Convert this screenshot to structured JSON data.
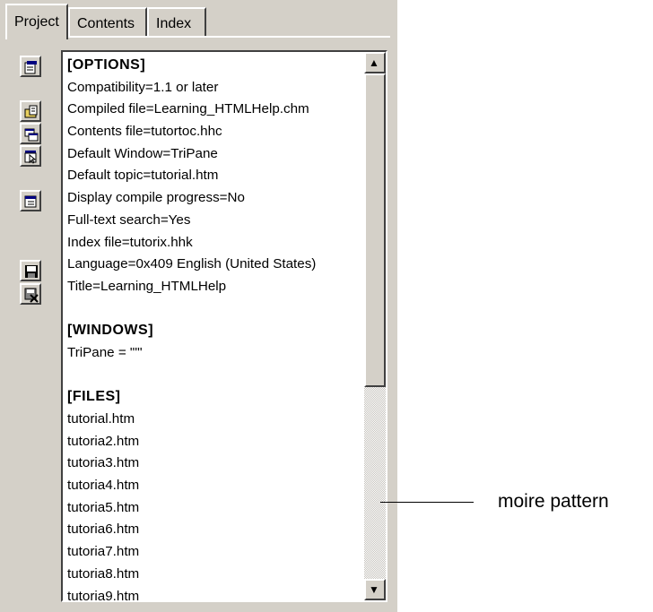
{
  "tabs": [
    {
      "label": "Project",
      "active": true
    },
    {
      "label": "Contents",
      "active": false
    },
    {
      "label": "Index",
      "active": false
    }
  ],
  "toolbar": {
    "buttons": [
      {
        "icon": "change-options-icon"
      },
      {
        "icon": "add-remove-files-icon"
      },
      {
        "icon": "add-modify-window-icon"
      },
      {
        "icon": "html-api-information-icon"
      },
      {
        "icon": "add-modify-information-types-icon"
      },
      {
        "icon": "save-project-icon"
      },
      {
        "icon": "save-all-and-compile-icon"
      }
    ]
  },
  "editor": {
    "options": {
      "header": "[OPTIONS]",
      "lines": [
        "Compatibility=1.1 or later",
        "Compiled file=Learning_HTMLHelp.chm",
        "Contents file=tutortoc.hhc",
        "Default Window=TriPane",
        "Default topic=tutorial.htm",
        "Display compile progress=No",
        "Full-text search=Yes",
        "Index file=tutorix.hhk",
        "Language=0x409 English (United States)",
        "Title=Learning_HTMLHelp"
      ]
    },
    "windows": {
      "header": "[WINDOWS]",
      "lines": [
        "TriPane = \"\"'"
      ]
    },
    "files": {
      "header": "[FILES]",
      "lines": [
        "tutorial.htm",
        "tutoria2.htm",
        "tutoria3.htm",
        "tutoria4.htm",
        "tutoria5.htm",
        "tutoria6.htm",
        "tutoria7.htm",
        "tutoria8.htm",
        "tutoria9.htm"
      ]
    }
  },
  "scrollbar": {
    "up_glyph": "▲",
    "down_glyph": "▼"
  },
  "annotation": {
    "label": "moire pattern"
  },
  "colors": {
    "face": "#d4d0c8",
    "highlight": "#ffffff",
    "shadow": "#404040"
  }
}
